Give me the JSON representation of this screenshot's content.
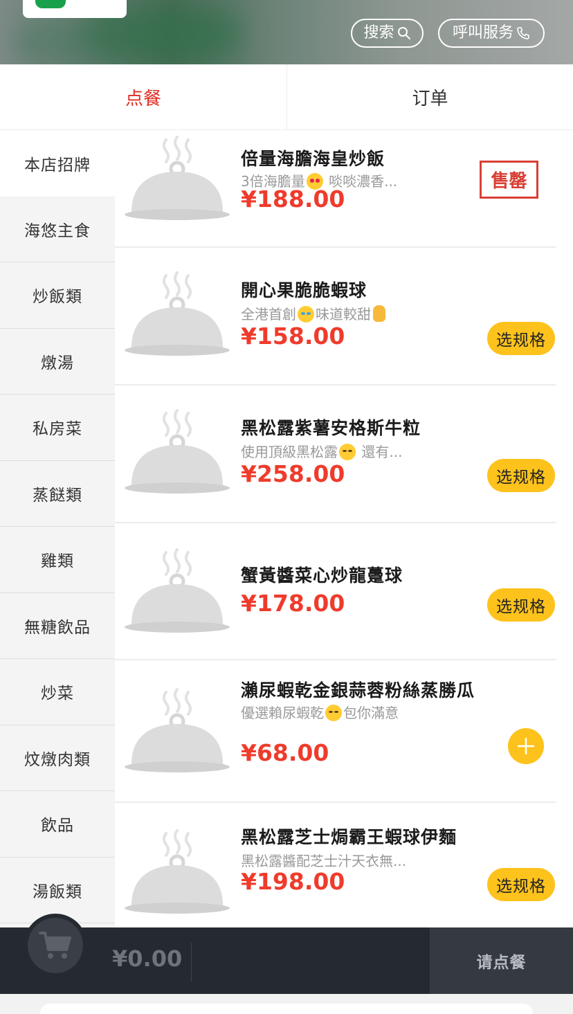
{
  "header": {
    "search_label": "搜索",
    "call_label": "呼叫服务"
  },
  "tabs": [
    {
      "label": "点餐",
      "active": true
    },
    {
      "label": "订单",
      "active": false
    }
  ],
  "sidebar": {
    "categories": [
      {
        "label": "本店招牌",
        "active": true
      },
      {
        "label": "海悠主食"
      },
      {
        "label": "炒飯類"
      },
      {
        "label": "燉湯"
      },
      {
        "label": "私房菜"
      },
      {
        "label": "蒸餸類"
      },
      {
        "label": "雞類"
      },
      {
        "label": "無糖飲品"
      },
      {
        "label": "炒菜"
      },
      {
        "label": "炆燉肉類"
      },
      {
        "label": "飲品"
      },
      {
        "label": "湯飯類"
      }
    ]
  },
  "items": [
    {
      "name": "倍量海膽海皇炒飯",
      "desc_a": "3倍海膽量",
      "desc_b": " 啖啖濃香...",
      "emoji": "heart-eyes-emoji",
      "price": "¥188.00",
      "action": "售罄"
    },
    {
      "name": "開心果脆脆蝦球",
      "desc_a": "全港首創",
      "desc_b": "味道較甜",
      "emoji": "laughing-emoji",
      "price": "¥158.00",
      "action": "选规格"
    },
    {
      "name": "黑松露紫薯安格斯牛粒",
      "desc_a": "使用頂級黑松露",
      "desc_b": " 還有...",
      "emoji": "hugging-emoji",
      "price": "¥258.00",
      "action": "选规格"
    },
    {
      "name": "蟹黃醬菜心炒龍躉球",
      "desc_a": "",
      "desc_b": "",
      "emoji": "",
      "price": "¥178.00",
      "action": "选规格"
    },
    {
      "name": "瀨尿蝦乾金銀蒜蓉粉絲蒸勝瓜",
      "desc_a": "優選賴尿蝦乾",
      "desc_b": "包你滿意",
      "emoji": "hugging-emoji",
      "price": "¥68.00",
      "action": "+"
    },
    {
      "name": "黑松露芝士焗霸王蝦球伊麵",
      "desc_a": "黑松露醬配芝士汁天衣無...",
      "desc_b": "",
      "emoji": "",
      "price": "¥198.00",
      "action": "选规格"
    }
  ],
  "cart": {
    "total": "¥0.00",
    "checkout_label": "请点餐"
  },
  "colors": {
    "accent_red": "#ef3b2c",
    "button_yellow": "#fdc21c",
    "cart_bar": "#252a31"
  }
}
